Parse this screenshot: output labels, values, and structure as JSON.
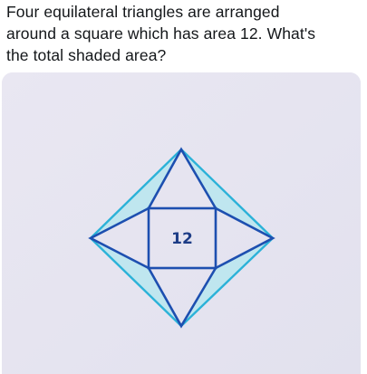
{
  "tweet": {
    "lines": [
      "Four equilateral triangles are arranged",
      "around a square which has area 12. What's",
      "the total shaded area?"
    ]
  },
  "figure": {
    "square_label": "12",
    "colors": {
      "paper": "#e6e4f0",
      "dark_blue": "#1d4fb0",
      "light_blue": "#27b3d6",
      "shade": "#bfe7f0"
    }
  }
}
